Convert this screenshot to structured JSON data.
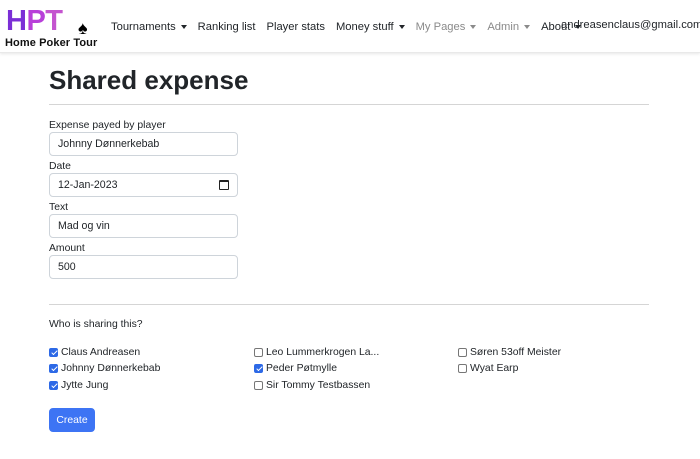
{
  "brand": {
    "letters": [
      "H",
      "P",
      "T"
    ],
    "subtitle": "Home Poker Tour",
    "spade_glyph": "♠",
    "colors": [
      "#7b2fd6",
      "#b83fd9",
      "#c454cf"
    ]
  },
  "nav": {
    "items": [
      {
        "label": "Tournaments",
        "dropdown": true,
        "muted": false
      },
      {
        "label": "Ranking list",
        "dropdown": false,
        "muted": false
      },
      {
        "label": "Player stats",
        "dropdown": false,
        "muted": false
      },
      {
        "label": "Money stuff",
        "dropdown": true,
        "muted": false
      },
      {
        "label": "My Pages",
        "dropdown": true,
        "muted": true
      },
      {
        "label": "Admin",
        "dropdown": true,
        "muted": true
      },
      {
        "label": "About",
        "dropdown": true,
        "muted": false
      }
    ],
    "user_email": "andreasenclaus@gmail.com"
  },
  "page": {
    "title": "Shared expense"
  },
  "form": {
    "payer_label": "Expense payed by player",
    "payer_value": "Johnny Dønnerkebab",
    "date_label": "Date",
    "date_value": "12-Jan-2023",
    "text_label": "Text",
    "text_value": "Mad og vin",
    "amount_label": "Amount",
    "amount_value": "500"
  },
  "sharing": {
    "question": "Who is sharing this?",
    "players": [
      {
        "name": "Claus Andreasen",
        "checked": true
      },
      {
        "name": "Johnny Dønnerkebab",
        "checked": true
      },
      {
        "name": "Jytte Jung",
        "checked": true
      },
      {
        "name": "Leo Lummerkrogen La...",
        "checked": false
      },
      {
        "name": "Peder Pøtmylle",
        "checked": true
      },
      {
        "name": "Sir Tommy Testbassen",
        "checked": false
      },
      {
        "name": "Søren 53off Meister",
        "checked": false
      },
      {
        "name": "Wyat Earp",
        "checked": false
      }
    ]
  },
  "actions": {
    "create_label": "Create",
    "accent": "#3d74f4"
  }
}
